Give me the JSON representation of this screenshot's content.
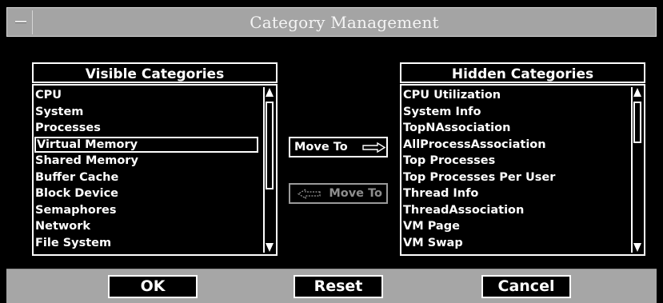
{
  "window": {
    "title": "Category Management"
  },
  "visible": {
    "header": "Visible Categories",
    "items": [
      "CPU",
      "System",
      "Processes",
      "Virtual Memory",
      "Shared Memory",
      "Buffer Cache",
      "Block Device",
      "Semaphores",
      "Network",
      "File System"
    ],
    "selected": "Virtual Memory"
  },
  "hidden": {
    "header": "Hidden Categories",
    "items": [
      "CPU Utilization",
      "System Info",
      "TopNAssociation",
      "AllProcessAssociation",
      "Top Processes",
      "Top Processes Per User",
      "Thread Info",
      "ThreadAssociation",
      "VM Page",
      "VM Swap"
    ]
  },
  "move": {
    "right_label": "Move To",
    "left_label": "Move To",
    "right_icon": "arrow-right-icon",
    "left_icon": "arrow-left-icon",
    "left_enabled": false
  },
  "buttons": {
    "ok": "OK",
    "reset": "Reset",
    "cancel": "Cancel"
  },
  "colors": {
    "background": "#000000",
    "chrome": "#a6a6a6",
    "foreground": "#ffffff",
    "disabled": "#8e8e8e"
  }
}
